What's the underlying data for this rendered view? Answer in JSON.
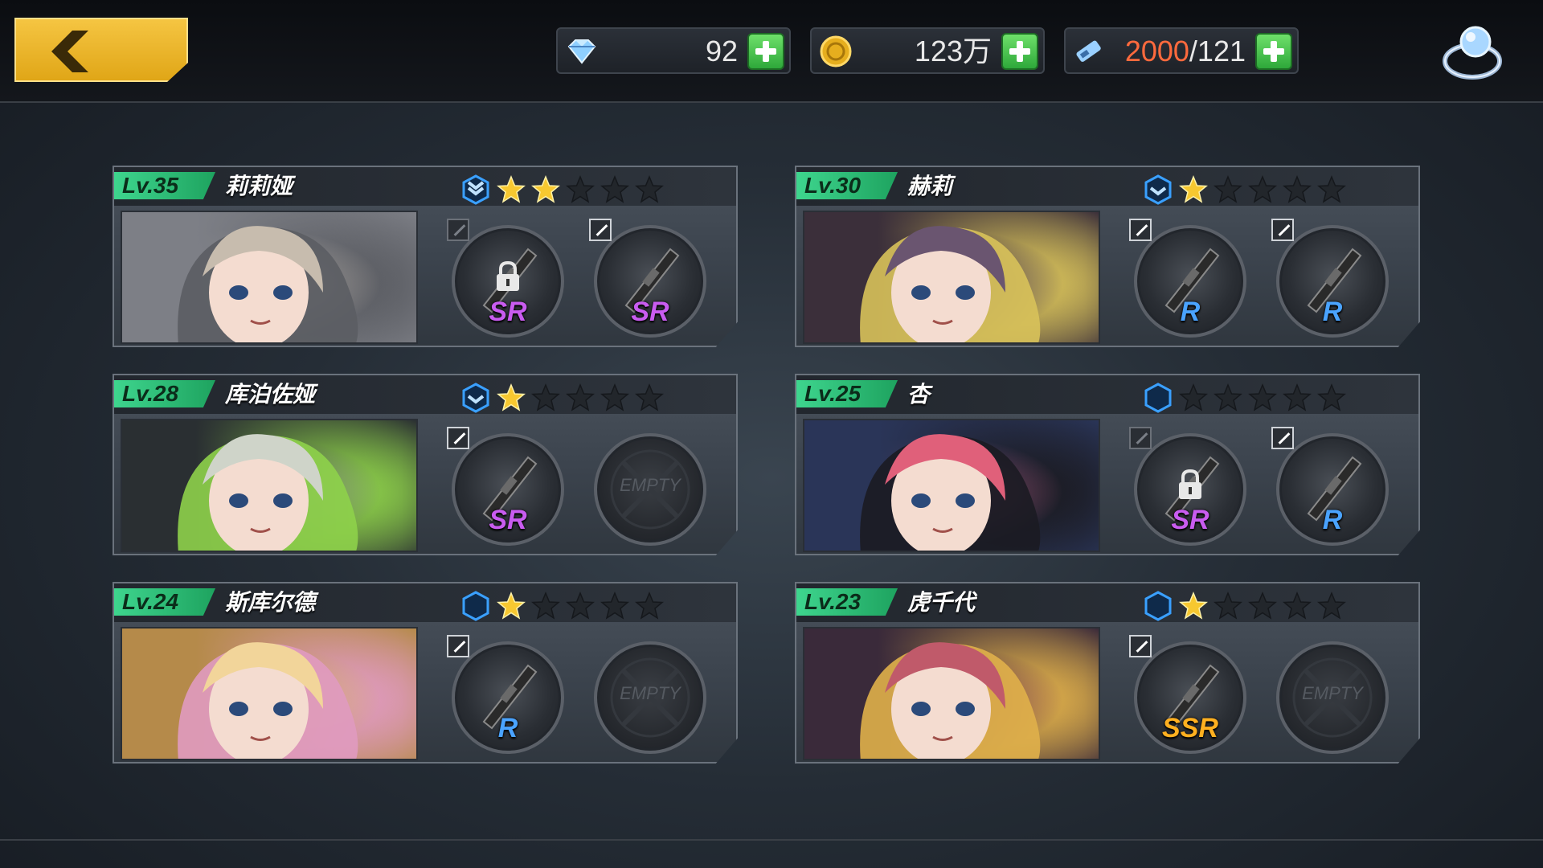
{
  "header": {
    "back_label": "",
    "resources": [
      {
        "id": "diamonds",
        "icon": "diamond-icon",
        "value": "92"
      },
      {
        "id": "gold",
        "icon": "gold-coin-icon",
        "value": "123万"
      },
      {
        "id": "stamina",
        "icon": "stamina-ticket-icon",
        "value_current": "2000",
        "value_max": "/121"
      }
    ]
  },
  "characters": [
    {
      "level": "Lv.35",
      "name": "莉莉娅",
      "rank": "rank-chevron-double",
      "stars": 2,
      "total_stars": 5,
      "slots": [
        {
          "type": "locked",
          "rarity": "SR"
        },
        {
          "type": "equipped",
          "rarity": "SR"
        }
      ]
    },
    {
      "level": "Lv.30",
      "name": "赫莉",
      "rank": "rank-chevron",
      "stars": 1,
      "total_stars": 5,
      "slots": [
        {
          "type": "equipped",
          "rarity": "R"
        },
        {
          "type": "equipped",
          "rarity": "R"
        }
      ]
    },
    {
      "level": "Lv.28",
      "name": "库泊佐娅",
      "rank": "rank-chevron",
      "stars": 1,
      "total_stars": 5,
      "slots": [
        {
          "type": "equipped",
          "rarity": "SR"
        },
        {
          "type": "empty",
          "label": "EMPTY"
        }
      ]
    },
    {
      "level": "Lv.25",
      "name": "杏",
      "rank": "rank-hex",
      "stars": 0,
      "total_stars": 5,
      "slots": [
        {
          "type": "locked",
          "rarity": "SR"
        },
        {
          "type": "equipped",
          "rarity": "R"
        }
      ]
    },
    {
      "level": "Lv.24",
      "name": "斯库尔德",
      "rank": "rank-hex",
      "stars": 1,
      "total_stars": 5,
      "slots": [
        {
          "type": "equipped",
          "rarity": "R"
        },
        {
          "type": "empty",
          "label": "EMPTY"
        }
      ]
    },
    {
      "level": "Lv.23",
      "name": "虎千代",
      "rank": "rank-hex",
      "stars": 1,
      "total_stars": 5,
      "slots": [
        {
          "type": "equipped",
          "rarity": "SSR"
        },
        {
          "type": "empty",
          "label": "EMPTY"
        }
      ]
    }
  ],
  "colors": {
    "accent_yellow": "#f5c542",
    "level_green": "#3ed58e",
    "star_gold": "#f7c830",
    "stamina_warn": "#ff6a3d",
    "plus_green": "#2ea83a"
  }
}
